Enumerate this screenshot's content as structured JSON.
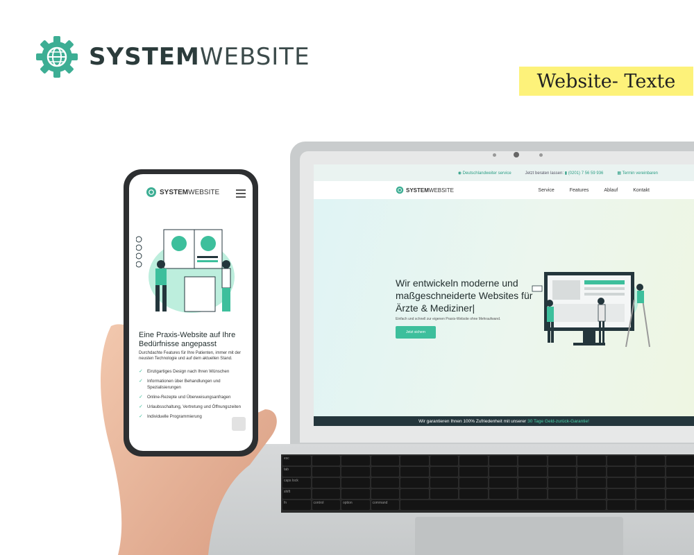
{
  "brand": {
    "name_bold": "SYSTEM",
    "name_light": "WEBSITE"
  },
  "tag": "Website- Texte",
  "laptop_site": {
    "topbar": [
      "Deutschlandweiter service",
      "Jetzt beraten lassen:",
      "(0201) 7 56 59 936",
      "Termin vereinbaren"
    ],
    "logo_bold": "SYSTEM",
    "logo_light": "WEBSITE",
    "nav": [
      "Service",
      "Features",
      "Ablauf",
      "Kontakt"
    ],
    "hero_heading": "Wir entwickeln moderne und maßgeschneiderte Websites für Ärzte & Mediziner|",
    "hero_sub": "Einfach und schnell zur eigenen Praxis-Website ohne Mehraufwand.",
    "hero_button": "Jetzt sichern",
    "guarantee_text": "Wir garantieren Ihnen 100% Zufriedenheit mit unserer",
    "guarantee_link": "30 Tage Geld-zurück-Garantie!"
  },
  "keyboard": [
    "esc",
    "tab",
    "caps lock",
    "shift",
    "fn",
    "control",
    "option",
    "command"
  ],
  "phone_site": {
    "logo_bold": "SYSTEM",
    "logo_light": "WEBSITE",
    "title": "Eine Praxis-Website auf Ihre Bedürfnisse angepasst",
    "desc": "Durchdachte Features für Ihre Patienten, immer mit der neusten Technologie und auf dem aktuellen Stand.",
    "features": [
      "Einzigartiges Design nach Ihren Wünschen",
      "Informationen über Behandlungen und Spezialisierungen",
      "Online-Rezepte und Überweisungsanfragen",
      "Urlaubsschaltung, Vertretung und Öffnungszeiten",
      "Individuelle Programmierung"
    ]
  },
  "colors": {
    "accent": "#3dbf9c",
    "dark": "#24363c",
    "highlight": "#fdf27a"
  },
  "icons": [
    "gear-globe-icon",
    "check-icon",
    "hamburger-menu-icon",
    "location-pin-icon",
    "phone-icon",
    "calendar-icon"
  ]
}
